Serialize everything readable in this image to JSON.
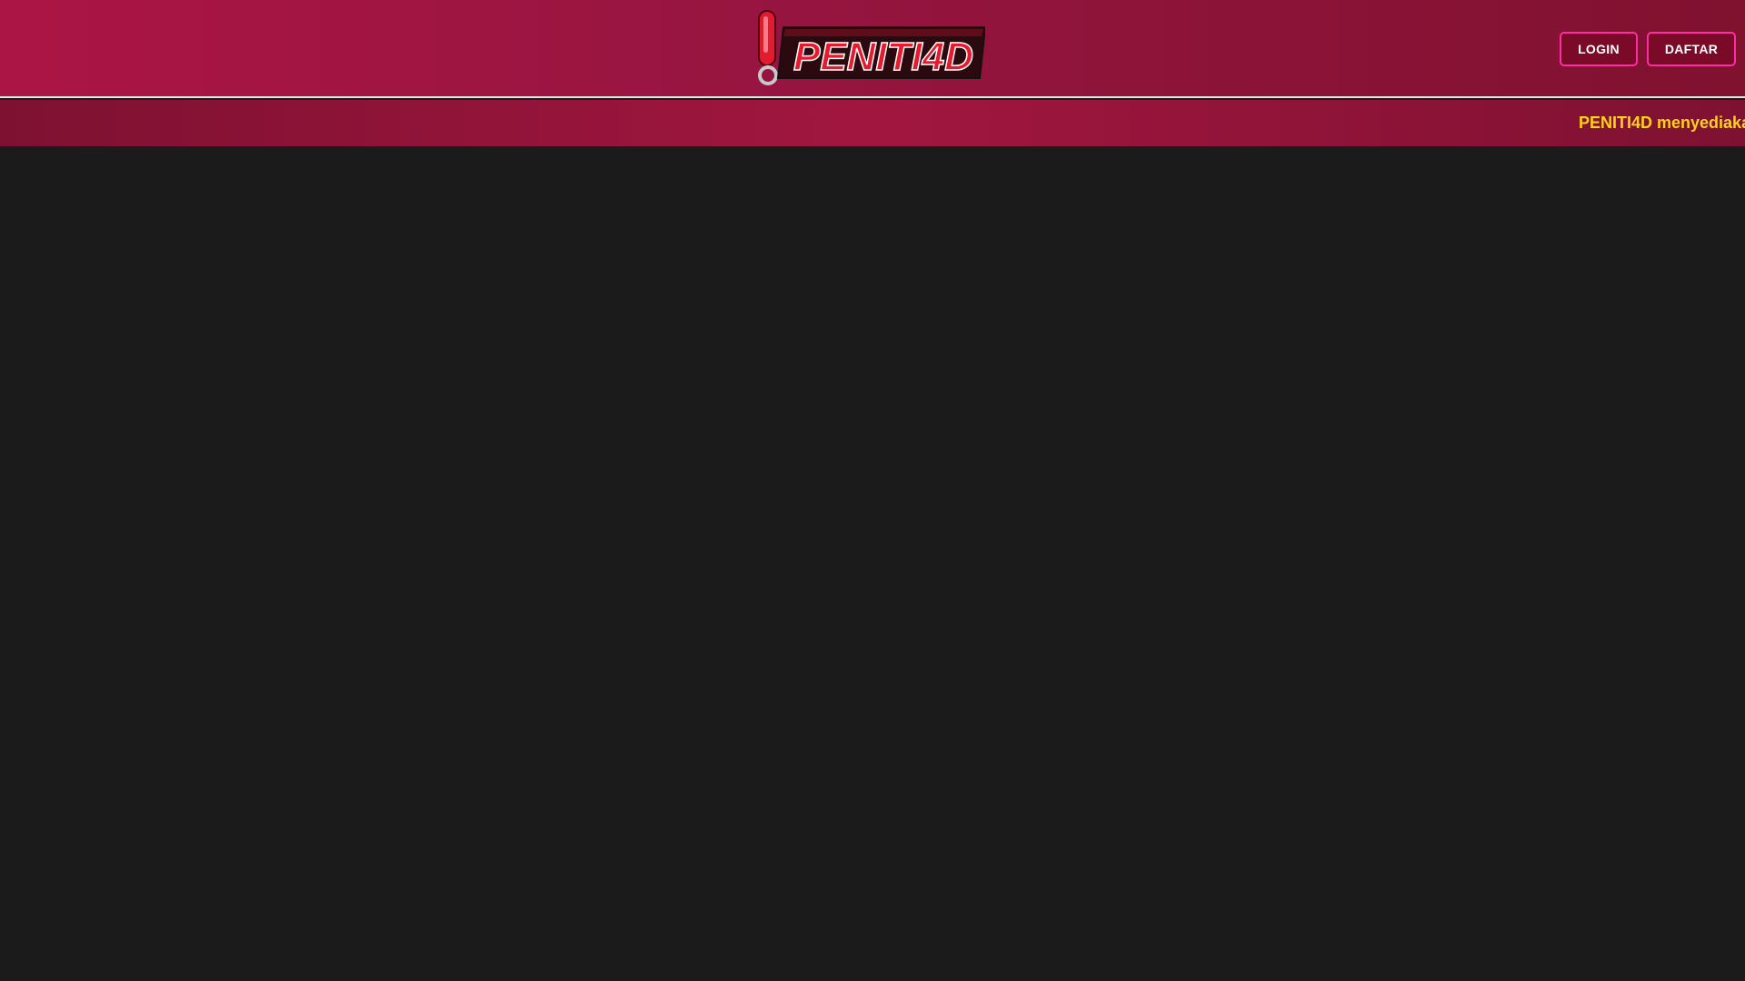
{
  "header": {
    "logo_text": "PENITI4D",
    "login_label": "LOGIN",
    "register_label": "DAFTAR"
  },
  "ticker": {
    "text": "PENITI4D menyediaka"
  },
  "colors": {
    "header_bg": "#9a1540",
    "button_border": "#ff2ca8",
    "ticker_text": "#ffd21a",
    "page_bg": "#1b1b1b"
  }
}
